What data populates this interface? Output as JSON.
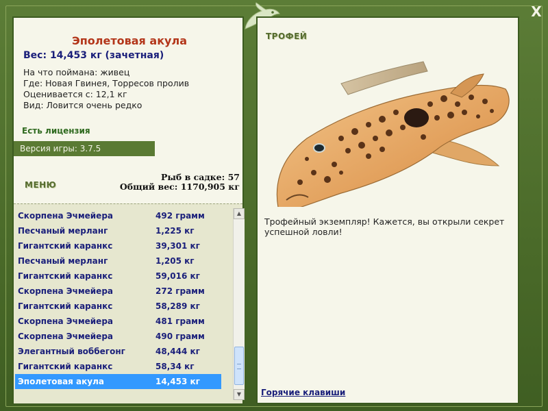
{
  "header": {
    "close_label": "X"
  },
  "fish": {
    "name": "Эполетовая акула",
    "weight_line": "Вес: 14,453 кг (зачетная)",
    "info": [
      "На что поймана: живец",
      "Где: Новая Гвинея, Торресов пролив",
      "Оценивается с: 12,1 кг",
      "Вид: Ловится очень редко"
    ]
  },
  "license_text": "Есть лицензия",
  "version_text": "Версия игры: 3.7.5",
  "menu_label": "МЕНЮ",
  "stats": {
    "fish_count": "Рыб в садке: 57",
    "total_weight": "Общий вес: 1170,905 кг"
  },
  "catch_list": [
    {
      "name": "Скорпена Эчмейера",
      "weight": "492 грамм"
    },
    {
      "name": "Песчаный мерланг",
      "weight": "1,225 кг"
    },
    {
      "name": "Гигантский каранкс",
      "weight": "39,301 кг"
    },
    {
      "name": "Песчаный мерланг",
      "weight": "1,205 кг"
    },
    {
      "name": "Гигантский каранкс",
      "weight": "59,016 кг"
    },
    {
      "name": "Скорпена Эчмейера",
      "weight": "272 грамм"
    },
    {
      "name": "Гигантский каранкс",
      "weight": "58,289 кг"
    },
    {
      "name": "Скорпена Эчмейера",
      "weight": "481 грамм"
    },
    {
      "name": "Скорпена Эчмейера",
      "weight": "490 грамм"
    },
    {
      "name": "Элегантный воббегонг",
      "weight": "48,444 кг"
    },
    {
      "name": "Гигантский каранкс",
      "weight": "58,34 кг"
    },
    {
      "name": "Эполетовая акула",
      "weight": "14,453 кг"
    }
  ],
  "selected_index": 11,
  "trophy": {
    "label": "ТРОФЕЙ",
    "text": "Трофейный экземпляр! Кажется, вы открыли секрет успешной ловли!"
  },
  "hotkeys_label": "Горячие клавиши",
  "colors": {
    "frame": "#4f6e2f",
    "panel": "#f6f6ea",
    "fish_name": "#b3361a",
    "list_text": "#1a1f7a",
    "selection": "#3399ff"
  },
  "icons": [
    "fish-logo-icon",
    "close-icon",
    "scroll-up-icon",
    "scroll-down-icon",
    "shark-image"
  ]
}
